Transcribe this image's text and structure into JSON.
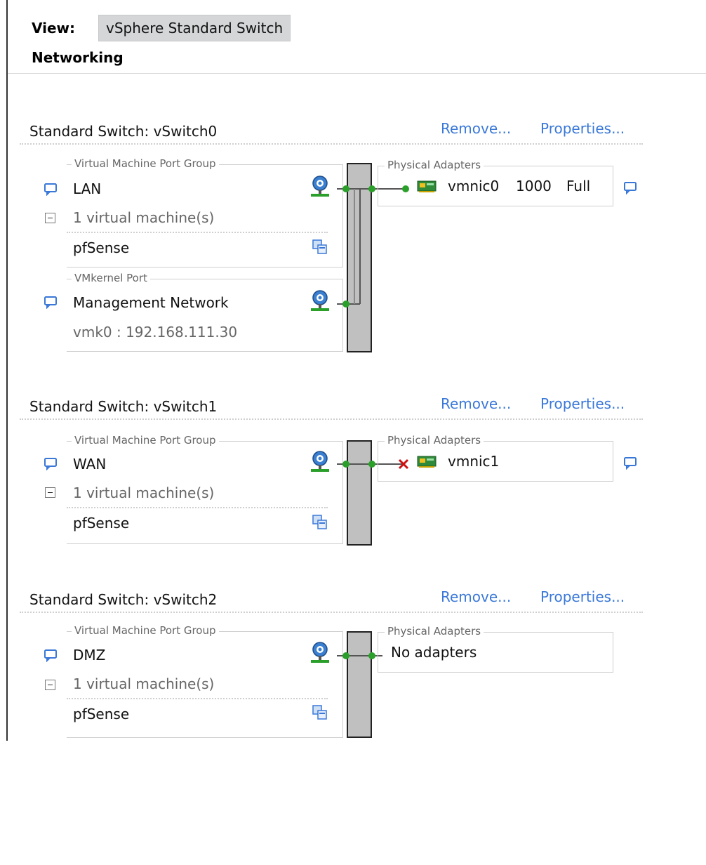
{
  "header": {
    "view_label": "View:",
    "view_value": "vSphere Standard Switch",
    "section_title": "Networking"
  },
  "switches": [
    {
      "title": "Standard Switch: vSwitch0",
      "remove_label": "Remove...",
      "properties_label": "Properties...",
      "port_groups": [
        {
          "type_label": "Virtual Machine Port Group",
          "name": "LAN",
          "vm_count_label": "1 virtual machine(s)",
          "vm_name": "pfSense"
        },
        {
          "type_label": "VMkernel Port",
          "name": "Management Network",
          "detail": "vmk0 : 192.168.111.30"
        }
      ],
      "physical_adapters": {
        "legend": "Physical Adapters",
        "nic": "vmnic0",
        "speed": "1000",
        "duplex": "Full",
        "status": "connected"
      }
    },
    {
      "title": "Standard Switch: vSwitch1",
      "remove_label": "Remove...",
      "properties_label": "Properties...",
      "port_groups": [
        {
          "type_label": "Virtual Machine Port Group",
          "name": "WAN",
          "vm_count_label": "1 virtual machine(s)",
          "vm_name": "pfSense"
        }
      ],
      "physical_adapters": {
        "legend": "Physical Adapters",
        "nic": "vmnic1",
        "status": "disconnected"
      }
    },
    {
      "title": "Standard Switch: vSwitch2",
      "remove_label": "Remove...",
      "properties_label": "Properties...",
      "port_groups": [
        {
          "type_label": "Virtual Machine Port Group",
          "name": "DMZ",
          "vm_count_label": "1 virtual machine(s)",
          "vm_name": "pfSense"
        }
      ],
      "physical_adapters": {
        "legend": "Physical Adapters",
        "empty_label": "No adapters"
      }
    }
  ],
  "icons": {
    "callout": "speech-bubble-icon",
    "network": "network-globe-icon",
    "vm": "virtual-machine-icon",
    "nic": "physical-nic-icon",
    "disconnected": "red-x-icon"
  },
  "colors": {
    "link": "#3a78d8",
    "port_green": "#2aa02a",
    "switch_fill": "#c0c0c0",
    "disconnect_red": "#cc1111"
  }
}
